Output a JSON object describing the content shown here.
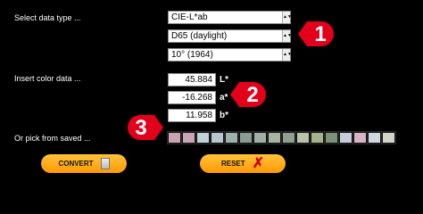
{
  "labels": {
    "select_data_type": "Select data type ...",
    "insert_color_data": "Insert color data ...",
    "pick_from_saved": "Or pick from saved ..."
  },
  "selects": {
    "color_space": "CIE-L*ab",
    "illuminant": "D65 (daylight)",
    "observer": "10° (1964)"
  },
  "inputs": [
    {
      "value": "45.884",
      "unit": "L*"
    },
    {
      "value": "-16.268",
      "unit": "a*"
    },
    {
      "value": "11.958",
      "unit": "b*"
    }
  ],
  "badges": [
    "1",
    "2",
    "3"
  ],
  "saved_swatches": [
    "#c9a3ad",
    "#c7a7b5",
    "#c2d1d8",
    "#b7c7cf",
    "#9fb1ad",
    "#8b9b93",
    "#a3b0a7",
    "#a8b3a2",
    "#8fa08f",
    "#b8c3a8",
    "#a4b38c",
    "#7d907a",
    "#c6ccd8",
    "#d6b3c6",
    "#d0d6df",
    "#d3d3c9"
  ],
  "buttons": {
    "convert": "CONVERT",
    "reset": "RESET"
  },
  "colors": {
    "accent_red": "#e3001b",
    "button_orange": "#ffa514"
  }
}
